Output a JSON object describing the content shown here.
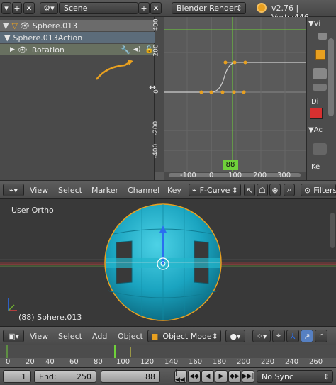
{
  "topbar": {
    "scene_label": "Scene",
    "renderer": "Blender Render",
    "version_info": "v2.76 | Verts:446"
  },
  "channels": {
    "items": [
      {
        "label": "Sphere.013"
      },
      {
        "label": "Sphere.013Action"
      },
      {
        "label": "Rotation"
      }
    ]
  },
  "graph": {
    "y_ticks": [
      "400",
      "200",
      "0",
      "-200",
      "-400"
    ],
    "x_ticks": [
      "-100",
      "0",
      "100",
      "200",
      "300"
    ],
    "current_frame": "88"
  },
  "toolshelf": {
    "labels": [
      "Vi",
      "Di",
      "Ac",
      "Ke"
    ]
  },
  "graph_header": {
    "menus": [
      "View",
      "Select",
      "Marker",
      "Channel",
      "Key"
    ],
    "mode": "F-Curve",
    "filters_label": "Filters"
  },
  "view3d": {
    "view_label": "User Ortho",
    "object_label": "(88) Sphere.013"
  },
  "view_header": {
    "menus": [
      "View",
      "Select",
      "Add",
      "Object"
    ],
    "mode": "Object Mode"
  },
  "timeline": {
    "ticks": [
      "0",
      "20",
      "40",
      "60",
      "80",
      "100",
      "120",
      "140",
      "160",
      "180",
      "200",
      "220",
      "240",
      "260"
    ]
  },
  "timeline_header": {
    "start_value": "1",
    "end_label": "End:",
    "end_value": "250",
    "current_value": "88",
    "sync": "No Sync"
  },
  "colors": {
    "accent_orange": "#e8a020",
    "frame_green": "#6fd13a",
    "sphere_cyan": "#1ab0c8",
    "axis_red": "#d84040",
    "axis_green": "#70b030",
    "axis_blue": "#2a6ff0"
  }
}
